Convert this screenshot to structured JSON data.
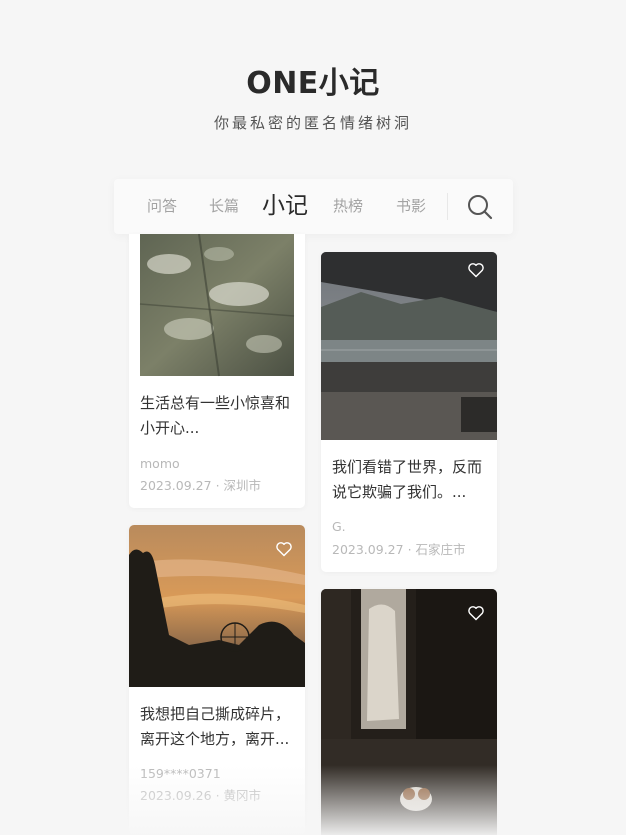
{
  "header": {
    "title": "ONE小记",
    "subtitle": "你最私密的匿名情绪树洞"
  },
  "tabs": [
    {
      "label": "问答",
      "active": false
    },
    {
      "label": "长篇",
      "active": false
    },
    {
      "label": "小记",
      "active": true
    },
    {
      "label": "热榜",
      "active": false
    },
    {
      "label": "书影",
      "active": false
    }
  ],
  "search": {
    "icon": "search-icon"
  },
  "cards": [
    {
      "text_line1": "生活总有一些小惊喜和",
      "text_line2": "小开心...",
      "author": "momo",
      "date": "2023.09.27",
      "location": "深圳市",
      "separator": "·",
      "image": "tree-shadow-on-stone"
    },
    {
      "text_line1": "我们看错了世界，反而",
      "text_line2": "说它欺骗了我们。...",
      "author": "G.",
      "date": "2023.09.27",
      "location": "石家庄市",
      "separator": "·",
      "image": "lake-mountain-balcony",
      "heart_icon": "heart-outline-icon"
    },
    {
      "text_line1": "我想把自己撕成碎片，",
      "text_line2": "离开这个地方，离开...",
      "author": "159****0371",
      "date": "2023.09.26",
      "location": "黄冈市",
      "separator": "·",
      "image": "sunset-ferris-wheel",
      "heart_icon": "heart-outline-icon"
    },
    {
      "image": "dark-room-dog",
      "heart_icon": "heart-outline-icon"
    }
  ],
  "colors": {
    "background": "#f6f6f6",
    "active_tab": "#2a2a2a",
    "inactive_tab": "#a3a3a3",
    "meta_text": "#b8b8b8"
  }
}
